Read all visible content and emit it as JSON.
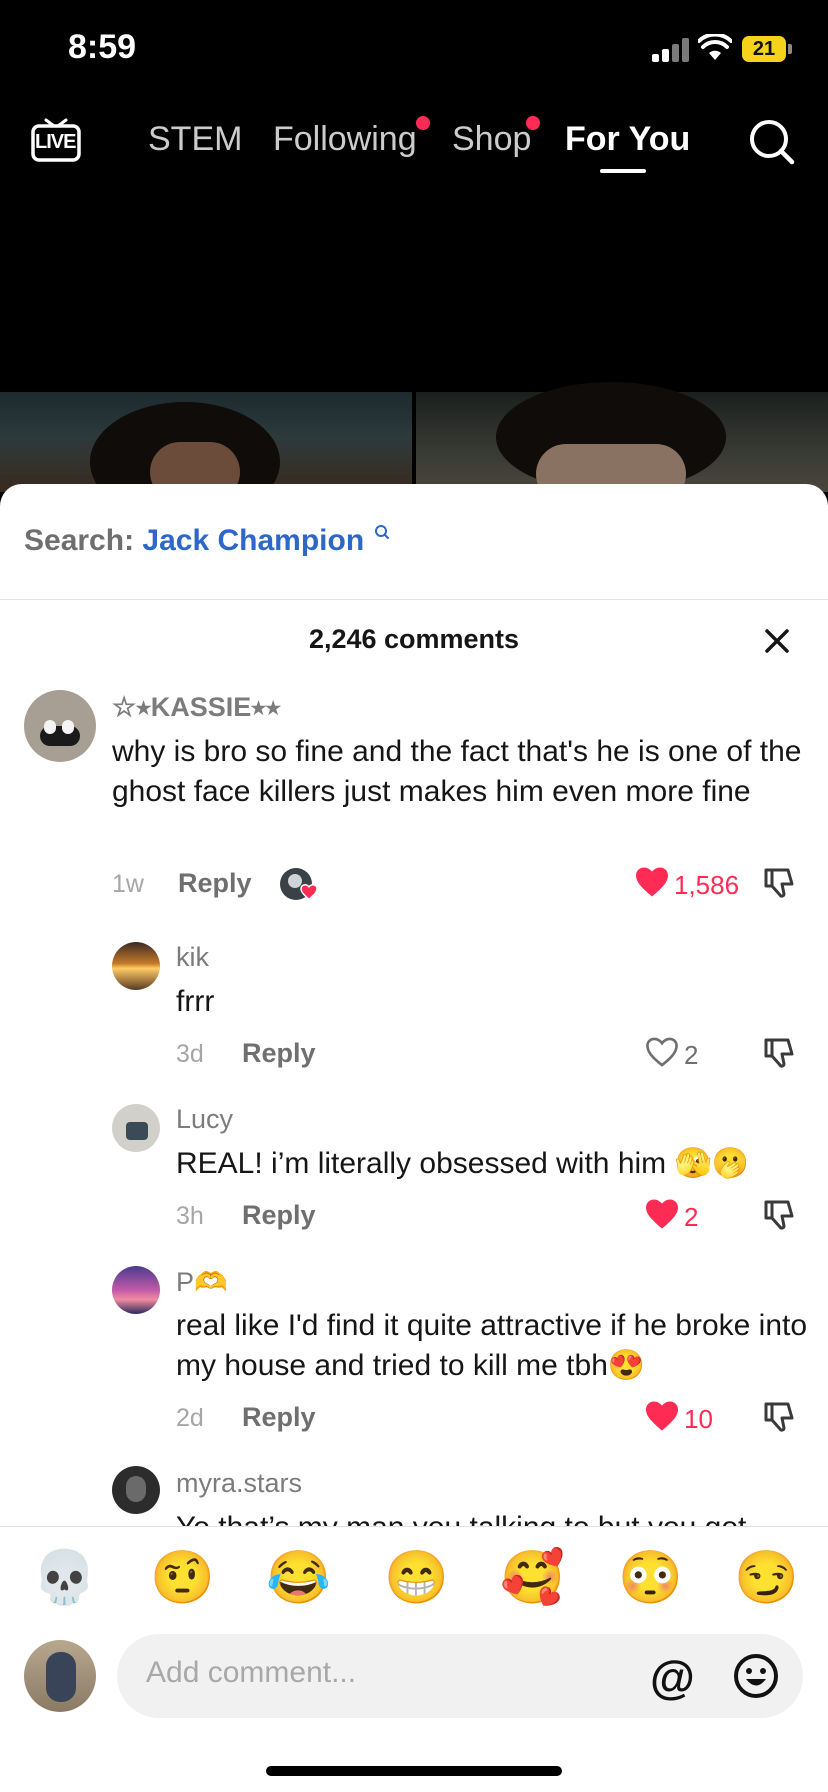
{
  "status": {
    "time": "8:59",
    "battery": "21"
  },
  "nav": {
    "live_label": "LIVE",
    "tabs": [
      "STEM",
      "Following",
      "Shop",
      "For You"
    ]
  },
  "search": {
    "prefix": "Search:",
    "term": "Jack Champion"
  },
  "comments_header": "2,246 comments",
  "comments": [
    {
      "user": "☆⭑KASSIE⭑⭑",
      "text": "why is bro so fine and the fact that's he is one of the ghost face killers just makes him even more fine",
      "time": "1w",
      "reply": "Reply",
      "likes": "1,586",
      "liked": true
    },
    {
      "user": "kik",
      "text": "frrr",
      "time": "3d",
      "reply": "Reply",
      "likes": "2",
      "liked": false
    },
    {
      "user": "Lucy",
      "text": "REAL! i’m literally obsessed with him 🫣🫢",
      "time": "3h",
      "reply": "Reply",
      "likes": "2",
      "liked": true
    },
    {
      "user": "P🫶",
      "text": "real like I'd find it quite attractive if he broke into my house and tried to kill me tbh😍",
      "time": "2d",
      "reply": "Reply",
      "likes": "10",
      "liked": true
    },
    {
      "user": "myra.stars",
      "text": "Yo that’s my man you talking to but you got"
    }
  ],
  "quick_emojis": [
    "💀",
    "🤨",
    "😂",
    "😁",
    "🥰",
    "😳",
    "😏"
  ],
  "input": {
    "placeholder": "Add comment...",
    "at": "@"
  },
  "colors": {
    "accent": "#fe2c55",
    "link": "#2d67c7"
  },
  "icons": [
    "live-icon",
    "search-icon",
    "close-icon",
    "heart-icon",
    "heart-outline-icon",
    "dislike-icon",
    "at-icon",
    "emoji-icon"
  ]
}
